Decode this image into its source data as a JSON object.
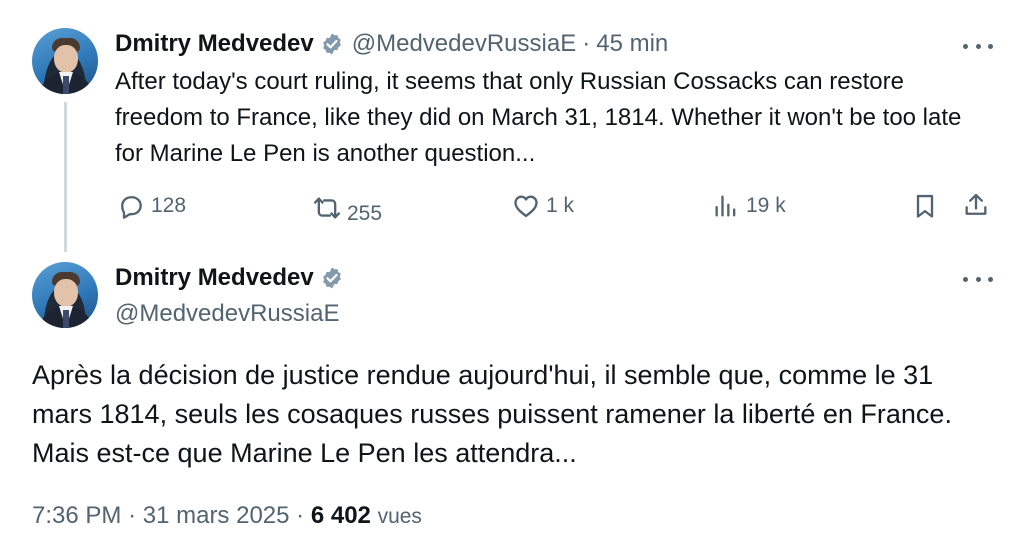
{
  "tweet": {
    "author_name": "Dmitry Medvedev",
    "handle": "@MedvedevRussiaE",
    "separator": "·",
    "time_ago": "45 min",
    "text": "After today's court ruling, it seems that only Russian Cossacks can restore freedom to France, like they did on March 31, 1814. Whether it won't be too late for Marine Le Pen is another question...",
    "actions": {
      "replies": "128",
      "reposts": "255",
      "likes": "1 k",
      "views": "19 k"
    }
  },
  "reply": {
    "author_name": "Dmitry Medvedev",
    "handle": "@MedvedevRussiaE",
    "text": "Après la décision de justice rendue aujourd'hui, il semble que, comme le 31 mars 1814, seuls les cosaques russes puissent ramener la liberté en France. Mais est-ce que Marine Le Pen les attendra...",
    "time": "7:36 PM",
    "date": "31 mars 2025",
    "meta_separator": "·",
    "views_count": "6 402",
    "views_label": "vues"
  },
  "colors": {
    "text": "#0f1419",
    "secondary": "#536471",
    "badge": "#829aab",
    "thread_line": "#cfd9de"
  },
  "icons": [
    "verified-badge-icon",
    "more-icon",
    "reply-icon",
    "repost-icon",
    "like-icon",
    "views-icon",
    "bookmark-icon",
    "share-icon"
  ]
}
